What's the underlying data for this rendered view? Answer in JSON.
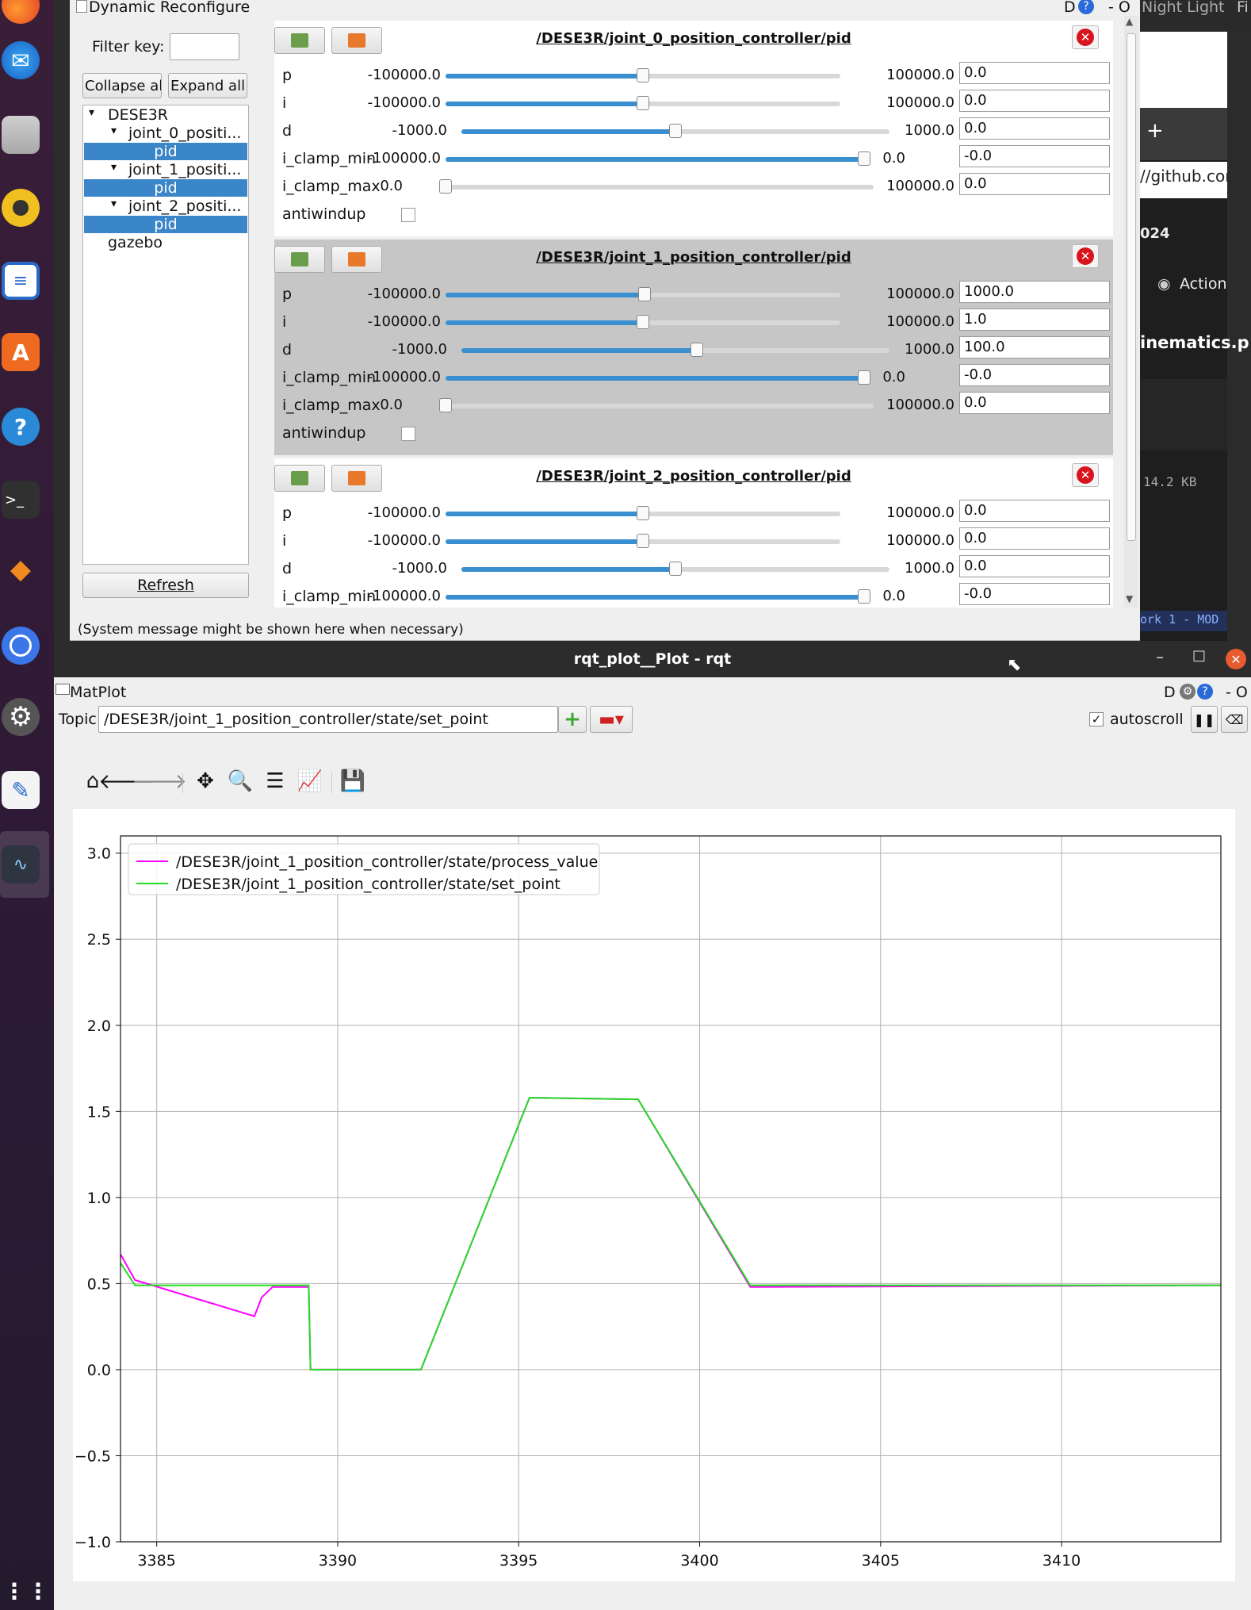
{
  "dock": {
    "icons": [
      "firefox-icon",
      "thunderbird-icon",
      "files-icon",
      "rhythmbox-icon",
      "writer-icon",
      "software-icon",
      "help-icon",
      "terminal-icon",
      "layers-icon",
      "signal-icon",
      "settings-icon",
      "editor-icon",
      "plot-icon"
    ],
    "grid_label": "⋮⋮"
  },
  "reconfigure": {
    "title": "Dynamic Reconfigure",
    "title_right": "D",
    "title_right2": "- O",
    "filter_label": "Filter key:",
    "filter_value": "",
    "collapse_label": "Collapse all",
    "expand_label": "Expand all",
    "tree": {
      "root": "DESE3R",
      "nodes": [
        "joint_0_positi...",
        "joint_1_positi...",
        "joint_2_positi..."
      ],
      "leaf": "pid",
      "other": "gazebo"
    },
    "refresh_label": "Refresh",
    "status": "(System message might be shown here when necessary)",
    "panels": [
      {
        "title": "/DESE3R/joint_0_position_controller/pid",
        "rows": [
          {
            "label": "p",
            "min": "-100000.0",
            "max": "100000.0",
            "value": "0.0",
            "pos": 0.5
          },
          {
            "label": "i",
            "min": "-100000.0",
            "max": "100000.0",
            "value": "0.0",
            "pos": 0.5
          },
          {
            "label": "d",
            "min": "-1000.0",
            "max": "1000.0",
            "value": "0.0",
            "pos": 0.5
          },
          {
            "label": "i_clamp_min",
            "min": "-100000.0",
            "max": "0.0",
            "value": "-0.0",
            "pos": 1.0
          },
          {
            "label": "i_clamp_max",
            "min": "0.0",
            "max": "100000.0",
            "value": "0.0",
            "pos": 0.0
          }
        ],
        "antiwindup": "antiwindup"
      },
      {
        "title": "/DESE3R/joint_1_position_controller/pid",
        "rows": [
          {
            "label": "p",
            "min": "-100000.0",
            "max": "100000.0",
            "value": "1000.0",
            "pos": 0.505
          },
          {
            "label": "i",
            "min": "-100000.0",
            "max": "100000.0",
            "value": "1.0",
            "pos": 0.5
          },
          {
            "label": "d",
            "min": "-1000.0",
            "max": "1000.0",
            "value": "100.0",
            "pos": 0.55
          },
          {
            "label": "i_clamp_min",
            "min": "-100000.0",
            "max": "0.0",
            "value": "-0.0",
            "pos": 1.0
          },
          {
            "label": "i_clamp_max",
            "min": "0.0",
            "max": "100000.0",
            "value": "0.0",
            "pos": 0.0
          }
        ],
        "antiwindup": "antiwindup"
      },
      {
        "title": "/DESE3R/joint_2_position_controller/pid",
        "rows": [
          {
            "label": "p",
            "min": "-100000.0",
            "max": "100000.0",
            "value": "0.0",
            "pos": 0.5
          },
          {
            "label": "i",
            "min": "-100000.0",
            "max": "100000.0",
            "value": "0.0",
            "pos": 0.5
          },
          {
            "label": "d",
            "min": "-1000.0",
            "max": "1000.0",
            "value": "0.0",
            "pos": 0.5
          },
          {
            "label": "i_clamp_min",
            "min": "-100000.0",
            "max": "0.0",
            "value": "-0.0",
            "pos": 1.0
          }
        ]
      }
    ]
  },
  "background_window": {
    "night_light": "Night Light",
    "corner": "Fi",
    "plus": "+",
    "url": "//github.com",
    "year": "024",
    "action": "Action",
    "filename": "inematics.p",
    "size": "14.2 KB",
    "status": "ork 1 - MOD"
  },
  "rqt": {
    "window_title": "rqt_plot__Plot - rqt",
    "plugin_title": "MatPlot",
    "plugin_right": "D",
    "plugin_right2": "- O",
    "topic_label": "Topic",
    "topic_value": "/DESE3R/joint_1_position_controller/state/set_point",
    "autoscroll_label": "autoscroll",
    "autoscroll_checked": true
  },
  "chart_data": {
    "type": "line",
    "title": "",
    "xlabel": "",
    "ylabel": "",
    "xlim": [
      3384,
      3414.4
    ],
    "ylim": [
      -1.0,
      3.1
    ],
    "xticks": [
      3385,
      3390,
      3395,
      3400,
      3405,
      3410
    ],
    "yticks": [
      -1.0,
      -0.5,
      0.0,
      0.5,
      1.0,
      1.5,
      2.0,
      2.5,
      3.0
    ],
    "grid": true,
    "legend_position": "top-left",
    "series": [
      {
        "name": "/DESE3R/joint_1_position_controller/state/process_value",
        "color": "#ff00ff",
        "x": [
          3384.0,
          3384.4,
          3387.7,
          3387.9,
          3388.2,
          3389.2,
          3389.25,
          3392.3,
          3395.3,
          3398.3,
          3401.4,
          3414.4
        ],
        "y": [
          0.67,
          0.52,
          0.31,
          0.42,
          0.48,
          0.48,
          0.0,
          0.0,
          1.58,
          1.57,
          0.48,
          0.49
        ]
      },
      {
        "name": "/DESE3R/joint_1_position_controller/state/set_point",
        "color": "#22dd22",
        "x": [
          3384.0,
          3384.4,
          3389.2,
          3389.25,
          3392.3,
          3395.3,
          3398.3,
          3401.4,
          3414.4
        ],
        "y": [
          0.62,
          0.49,
          0.49,
          0.0,
          0.0,
          1.58,
          1.57,
          0.49,
          0.49
        ]
      }
    ]
  }
}
